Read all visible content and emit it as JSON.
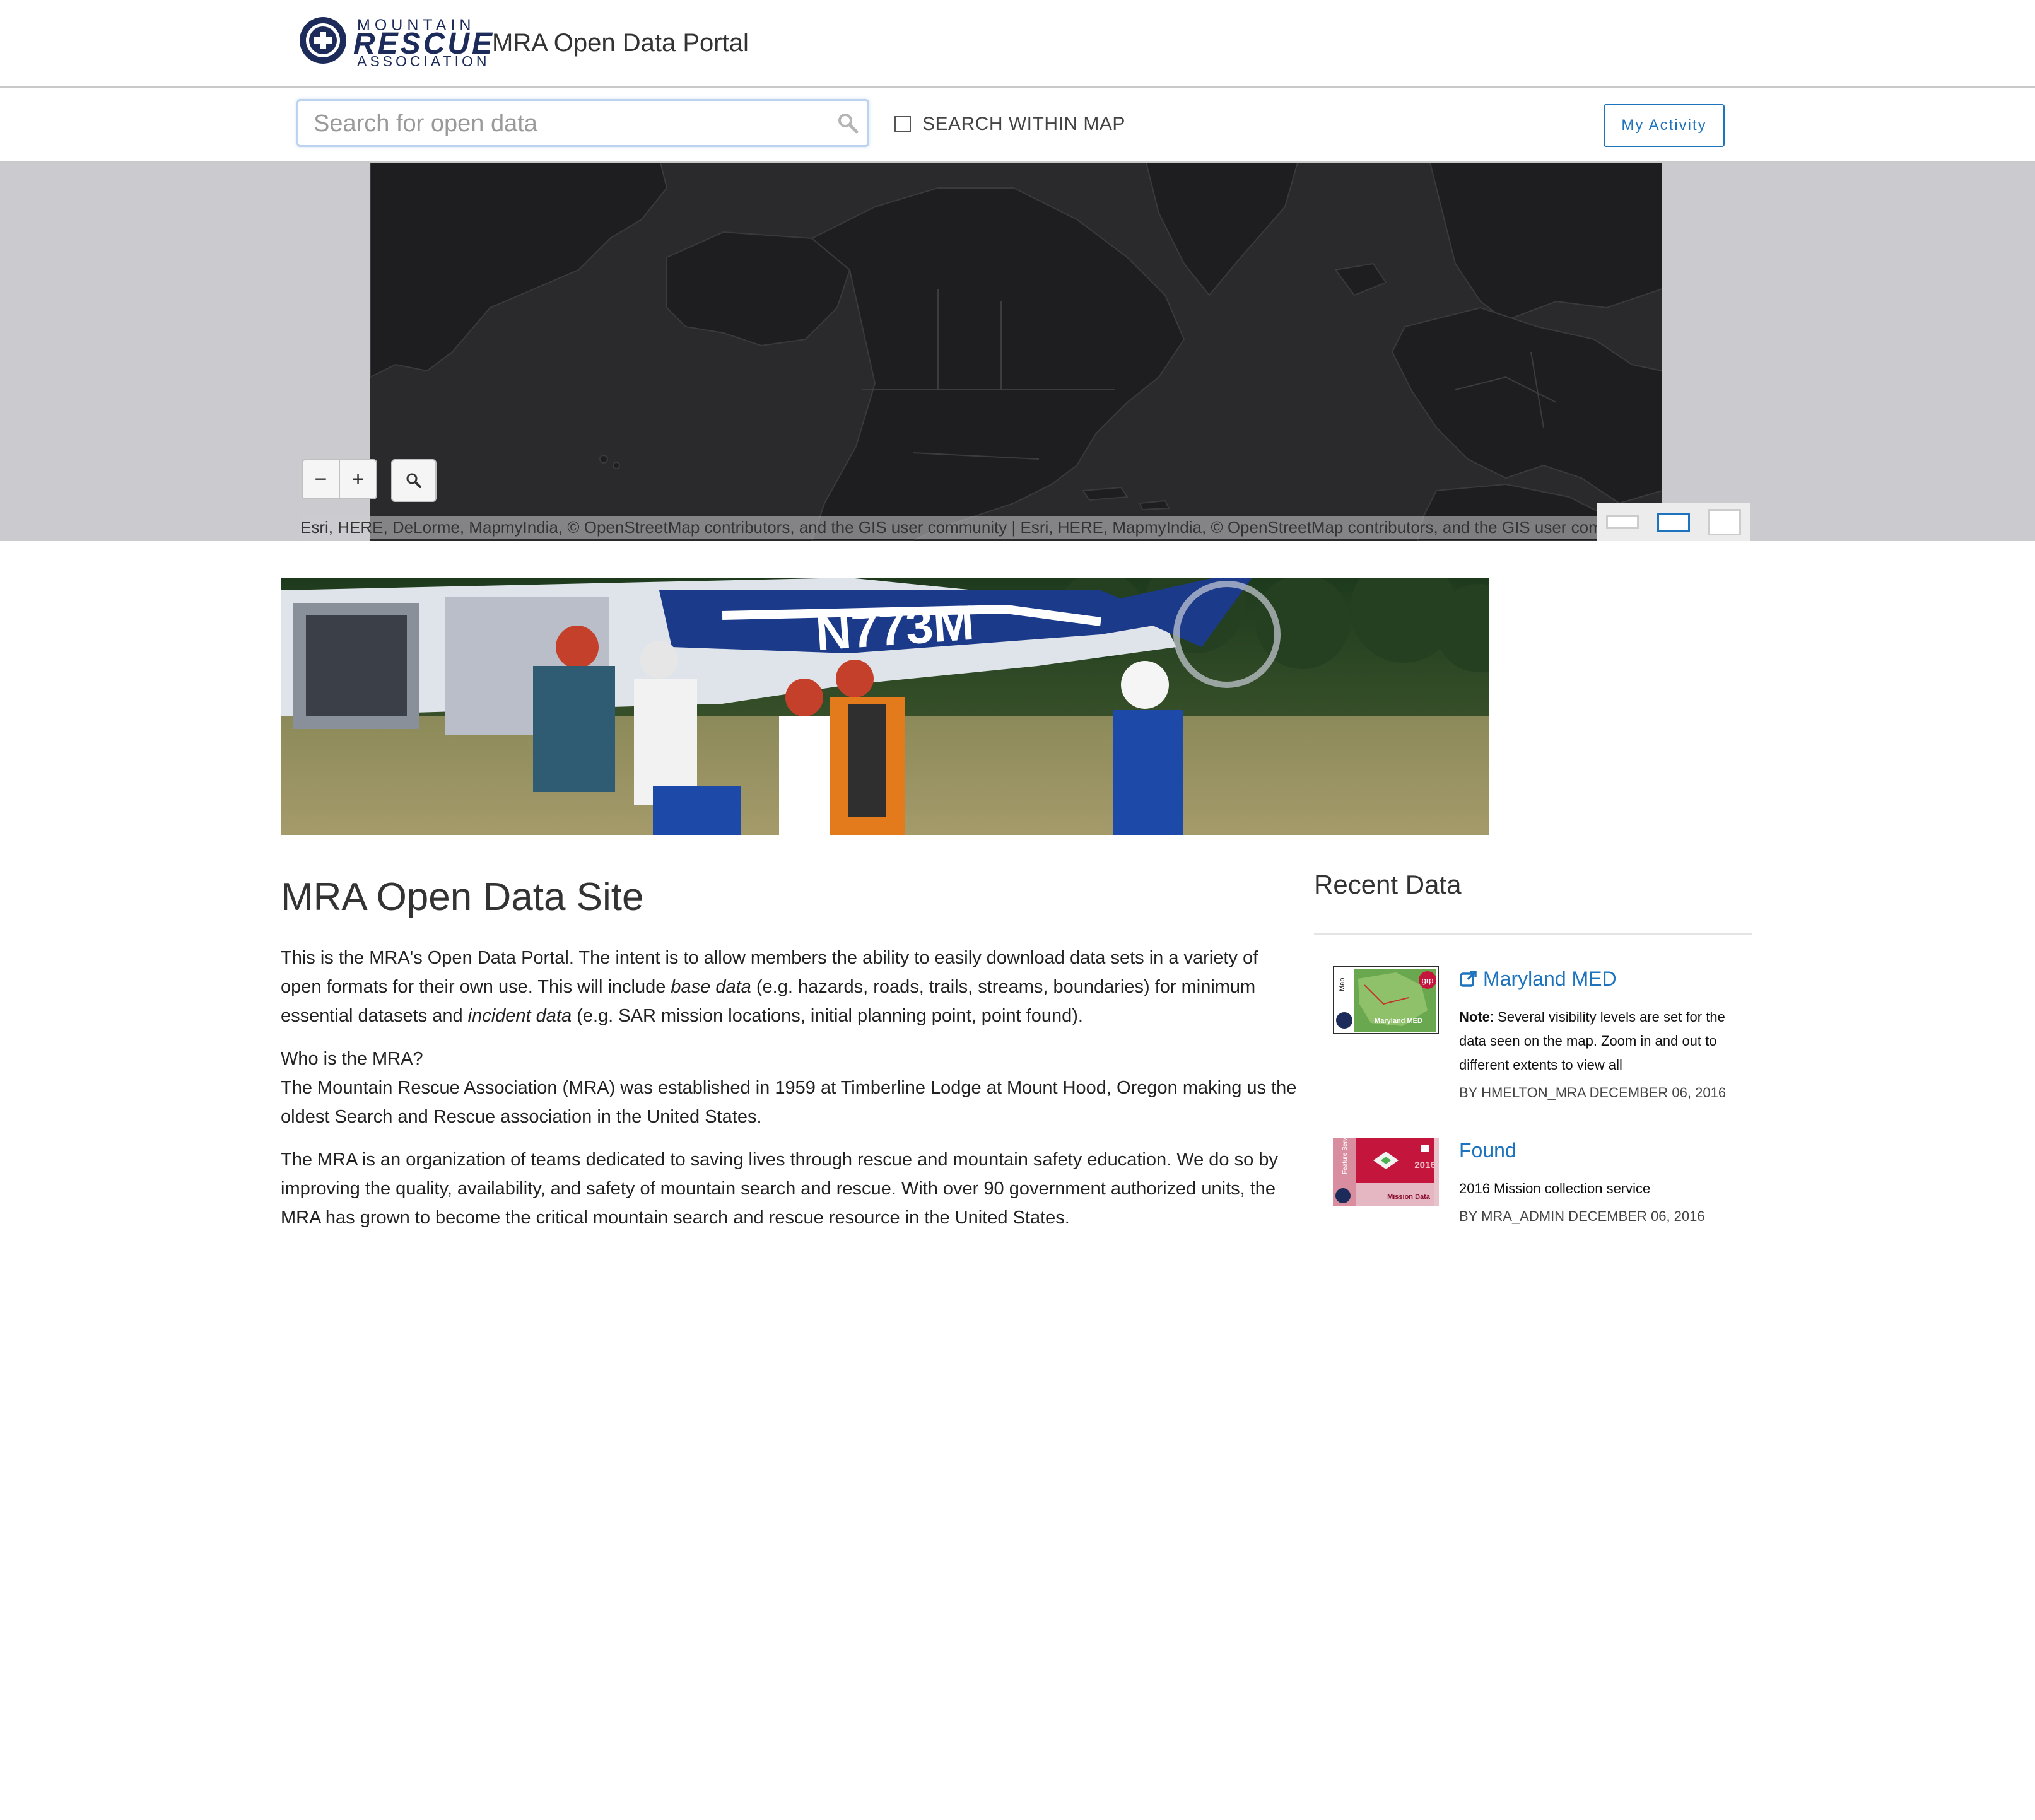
{
  "header": {
    "logo": {
      "line1": "MOUNTAIN",
      "line2": "RESCUE",
      "line3": "ASSOCIATION"
    },
    "portal_title": "MRA Open Data Portal"
  },
  "search": {
    "placeholder": "Search for open data",
    "value": "",
    "within_map_label": "SEARCH WITHIN MAP",
    "within_map_checked": false,
    "my_activity_label": "My Activity"
  },
  "map": {
    "zoom_out": "−",
    "zoom_in": "+",
    "attribution": "Esri, HERE, DeLorme, MapmyIndia, © OpenStreetMap contributors, and the GIS user community | Esri, HERE, MapmyIndia, © OpenStreetMap contributors, and the GIS user community",
    "land_color": "#1e1e21",
    "ocean_color": "#2a2a2d"
  },
  "main": {
    "title": "MRA Open Data Site",
    "intro_a": "This is the MRA's Open Data Portal. The intent is to allow members the ability to easily download data sets in a variety of open formats for their own use. This will include ",
    "intro_em1": "base data",
    "intro_b": " (e.g. hazards, roads, trails, streams, boundaries) for minimum essential datasets and ",
    "intro_em2": "incident data",
    "intro_c": " (e.g. SAR mission locations, initial planning point, point found).",
    "who_heading": "Who is the MRA?",
    "who_text": "The Mountain Rescue Association (MRA) was established in 1959 at Timberline Lodge at Mount Hood, Oregon making us the oldest Search and Rescue association in the United States.",
    "org_text": "The MRA is an organization of teams dedicated to saving lives through rescue and mountain safety education. We do so by improving the quality, availability, and safety of mountain search and rescue. With over 90 government authorized units, the MRA has grown to become the critical mountain search and rescue resource in the United States."
  },
  "recent": {
    "heading": "Recent Data",
    "items": [
      {
        "title": "Maryland MED",
        "desc_label": "Note",
        "desc": ": Several visibility levels are set for the data seen on the map. Zoom in and out to different extents to view all",
        "meta": "BY HMELTON_MRA DECEMBER 06, 2016",
        "thumb_type": "Map",
        "thumb_caption": "Maryland MED",
        "thumb_badge": "grp"
      },
      {
        "title": "Found",
        "desc": "2016 Mission collection service",
        "meta": "BY MRA_ADMIN DECEMBER 06, 2016",
        "thumb_type": "Feature Service",
        "thumb_caption": "Mission Data",
        "thumb_year": "2016"
      }
    ]
  },
  "colors": {
    "accent": "#1e73be",
    "header_border": "#c9c9c9",
    "map_backdrop": "#cbcbcf",
    "thumb_red": "#c4163d"
  }
}
